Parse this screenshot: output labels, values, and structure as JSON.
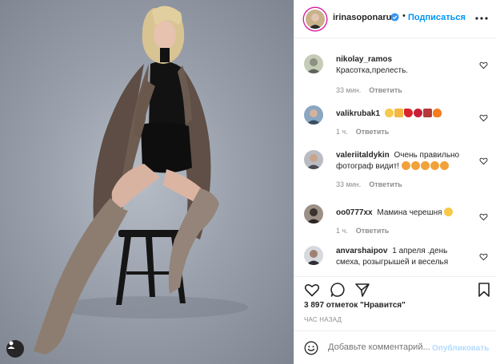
{
  "post": {
    "author": "irinasoponaru",
    "follow_label": "Подписаться",
    "separator": "•"
  },
  "comments": [
    {
      "username": "nikolay_ramos",
      "text": "Красотка,прелесть.",
      "age": "33 мин.",
      "reply_label": "Ответить"
    },
    {
      "username": "valikrubak1",
      "text": "",
      "emojis": [
        "neutral-face",
        "thumbs-up",
        "red-heart",
        "rose",
        "bouquet",
        "fire"
      ],
      "age": "1 ч.",
      "reply_label": "Ответить"
    },
    {
      "username": "valeriitaldykin",
      "text": "Очень правильно фотограф видит!",
      "emojis": [
        "heart-eyes",
        "heart-eyes",
        "heart-eyes",
        "heart-eyes",
        "heart-eyes"
      ],
      "age": "33 мин.",
      "reply_label": "Ответить"
    },
    {
      "username": "oo0777xx",
      "text": "Мамина черешня",
      "emojis": [
        "grinning-face"
      ],
      "age": "1 ч.",
      "reply_label": "Ответить"
    },
    {
      "username": "anvarshaipov",
      "text": "1 апреля .день смеха, розыгрышей и веселья",
      "age": "",
      "reply_label": ""
    }
  ],
  "likes": "3 897 отметок \"Нравится\"",
  "timestamp": "ЧАС НАЗАД",
  "add_comment": {
    "placeholder": "Добавьте комментарий...",
    "publish_label": "Опубликовать"
  },
  "colors": {
    "link_blue": "#0095f6",
    "publish_disabled": "#b3dbff",
    "meta_gray": "#8e8e8e",
    "border": "#efefef"
  },
  "icons": {
    "heart": "heart-icon",
    "comment": "comment-icon",
    "share": "paper-plane-icon",
    "save": "bookmark-icon",
    "more": "more-icon",
    "emoji": "smiley-icon",
    "user_tag": "user-tag-icon"
  }
}
